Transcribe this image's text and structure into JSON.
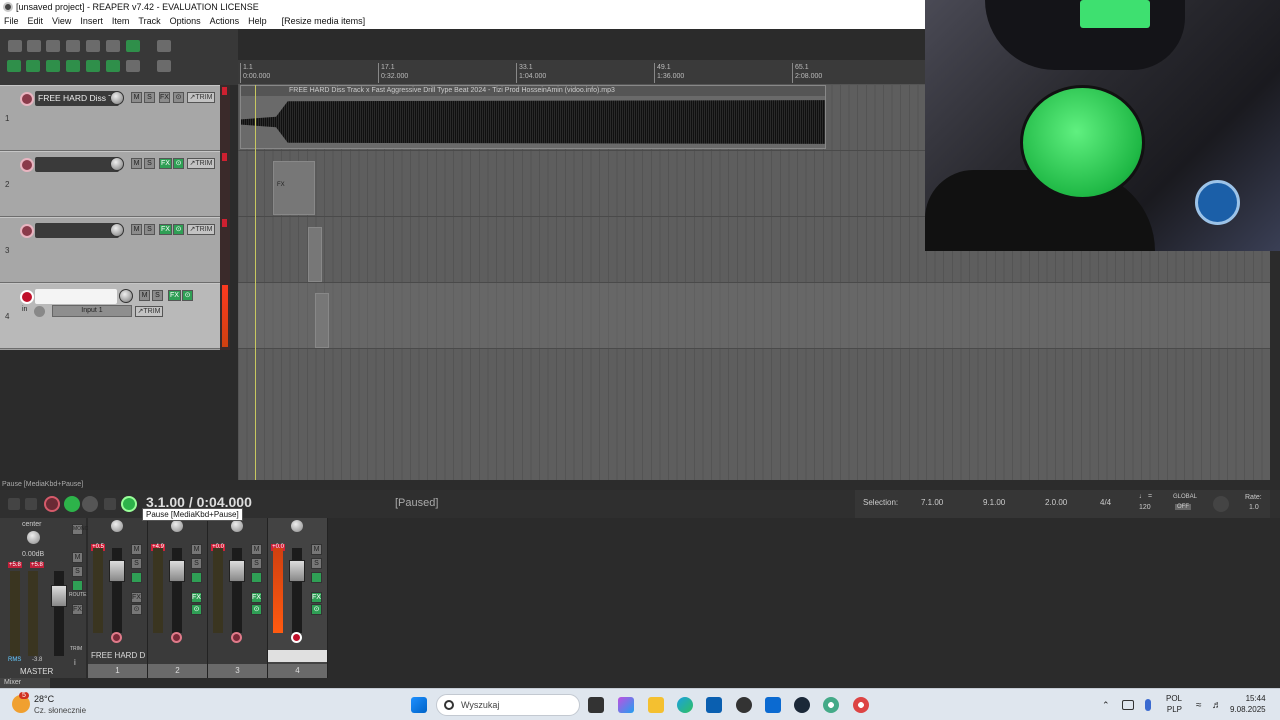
{
  "window": {
    "title": "[unsaved project] - REAPER v7.42 - EVALUATION LICENSE"
  },
  "menu": [
    "File",
    "Edit",
    "View",
    "Insert",
    "Item",
    "Track",
    "Options",
    "Actions",
    "Help",
    "[Resize media items]"
  ],
  "ruler": [
    {
      "bar": "1.1",
      "time": "0:00.000"
    },
    {
      "bar": "17.1",
      "time": "0:32.000"
    },
    {
      "bar": "33.1",
      "time": "1:04.000"
    },
    {
      "bar": "49.1",
      "time": "1:36.000"
    },
    {
      "bar": "65.1",
      "time": "2:08.000"
    }
  ],
  "tracks": [
    {
      "num": "1",
      "name": "FREE HARD Diss Tr"
    },
    {
      "num": "2",
      "name": ""
    },
    {
      "num": "3",
      "name": ""
    },
    {
      "num": "4",
      "name": "",
      "input": "Input 1",
      "in_label": "in"
    }
  ],
  "track_buttons": {
    "mute": "M",
    "solo": "S",
    "fx": "FX",
    "io": "⊙",
    "trim": "↗TRIM"
  },
  "item": {
    "title": "FREE HARD Diss Track x Fast Aggressive Drill Type Beat 2024 - Tizi Prod HosseinAmin (vidoo.info).mp3",
    "fx_tag": "FX"
  },
  "status": {
    "action": "Pause [MediaKbd+Pause]"
  },
  "transport": {
    "timecode": "3.1.00 / 0:04.000",
    "state": "[Paused]",
    "tooltip": "Pause [MediaKbd+Pause]"
  },
  "selection": {
    "label": "Selection:",
    "start": "7.1.00",
    "end": "9.1.00",
    "length": "2.0.00",
    "timesig": "4/4",
    "bpm": "120",
    "bpm_icon": "♩ =",
    "global": "GLOBAL",
    "off": "OFF",
    "rate_label": "Rate:",
    "rate": "1.0"
  },
  "mixer": {
    "master": {
      "pan": "center",
      "vol": "0.00dB",
      "peak_l": "+5.8",
      "peak_r": "+5.8",
      "rms": "RMS",
      "rms_val": "-3.8",
      "label": "MASTER",
      "mono": "MONO",
      "route": "ROUTE",
      "trim": "TRIM",
      "mute": "M",
      "solo": "S",
      "fx": "FX",
      "info": "i"
    },
    "strips": [
      {
        "peak": "+0.5",
        "num": "1",
        "name": "FREE HARD D"
      },
      {
        "peak": "+4.9",
        "num": "2",
        "name": ""
      },
      {
        "peak": "+0.0",
        "num": "3",
        "name": ""
      },
      {
        "peak": "+0.0",
        "num": "4",
        "name": ""
      }
    ],
    "tab": "Mixer"
  },
  "taskbar": {
    "weather_temp": "28°C",
    "weather_desc": "Cz. słonecznie",
    "search": "Wyszukaj",
    "lang1": "POL",
    "lang2": "PLP",
    "time": "15:44",
    "date": "9.08.2025",
    "badge": "5"
  },
  "colors": {
    "accent": "#2db34a",
    "record": "#c0102a",
    "headset": "#3ee070"
  }
}
